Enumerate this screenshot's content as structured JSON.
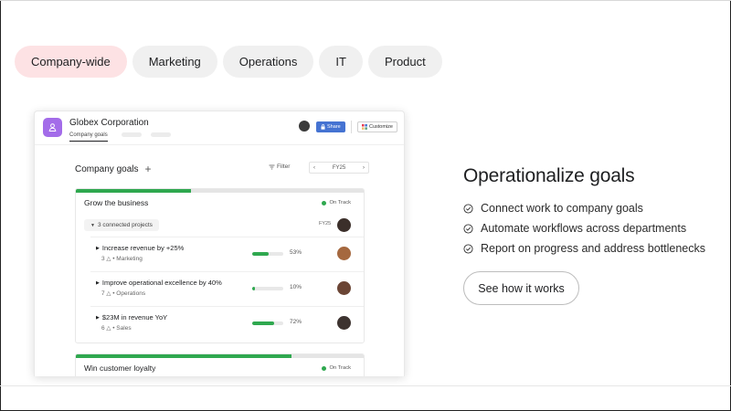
{
  "filters": {
    "items": [
      {
        "label": "Company-wide",
        "active": true
      },
      {
        "label": "Marketing",
        "active": false
      },
      {
        "label": "Operations",
        "active": false
      },
      {
        "label": "IT",
        "active": false
      },
      {
        "label": "Product",
        "active": false
      }
    ]
  },
  "app": {
    "org_name": "Globex Corporation",
    "active_tab": "Company goals",
    "share_label": "Share",
    "customize_label": "Customize",
    "section_title": "Company goals",
    "filter_label": "Filter",
    "period": "FY25"
  },
  "goals": [
    {
      "name": "Grow the business",
      "status": "On Track",
      "progress": 0.4,
      "projects_label": "3 connected projects",
      "period": "FY25",
      "sub_goals": [
        {
          "name": "Increase revenue by +25%",
          "meta": "3 △ • Marketing",
          "percent": "53%",
          "progress": 0.53
        },
        {
          "name": "Improve operational excellence by 40%",
          "meta": "7 △ • Operations",
          "percent": "10%",
          "progress": 0.1
        },
        {
          "name": "$23M in revenue YoY",
          "meta": "6 △ • Sales",
          "percent": "72%",
          "progress": 0.72
        }
      ]
    },
    {
      "name": "Win customer loyalty",
      "status": "On Track",
      "progress": 0.75
    }
  ],
  "feature": {
    "headline": "Operationalize goals",
    "bullets": [
      "Connect work to company goals",
      "Automate workflows across departments",
      "Report on progress and address bottlenecks"
    ],
    "cta_label": "See how it works"
  },
  "colors": {
    "active_pill": "#fde2e4",
    "pill": "#f0f0f0",
    "progress_green": "#2fa84f",
    "share_blue": "#4573d2",
    "app_icon_purple": "#a36ce9"
  }
}
